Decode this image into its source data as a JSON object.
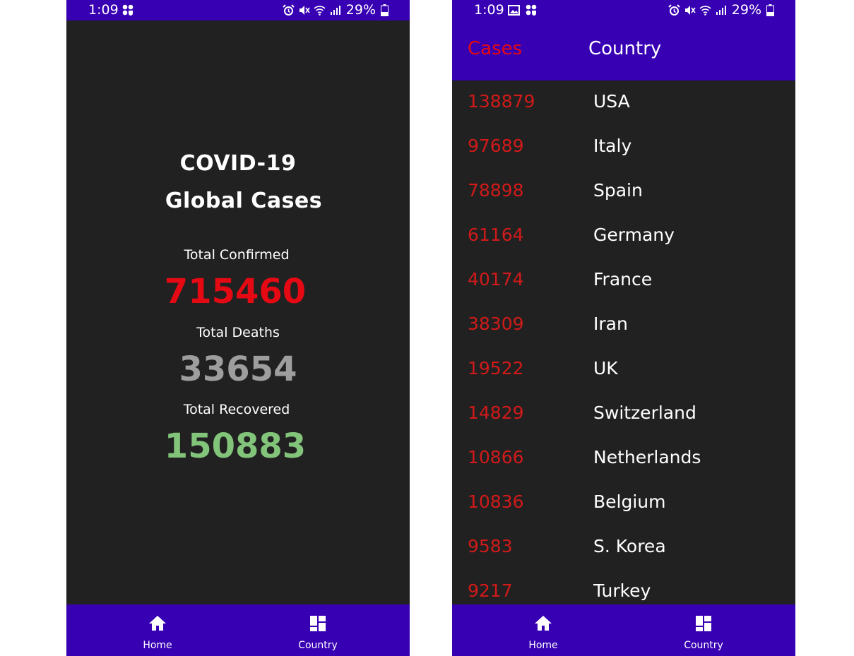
{
  "status_bar": {
    "time": "1:09",
    "battery_percent": "29%"
  },
  "home_screen": {
    "title_line1": "COVID-19",
    "title_line2": "Global Cases",
    "confirmed_label": "Total Confirmed",
    "confirmed_value": "715460",
    "deaths_label": "Total Deaths",
    "deaths_value": "33654",
    "recovered_label": "Total Recovered",
    "recovered_value": "150883",
    "colors": {
      "confirmed": "#e50914",
      "deaths": "#9e9e9e",
      "recovered": "#81c47a"
    }
  },
  "country_screen": {
    "header": {
      "cases_label": "Cases",
      "country_label": "Country"
    },
    "rows": [
      {
        "cases": "138879",
        "country": "USA"
      },
      {
        "cases": "97689",
        "country": "Italy"
      },
      {
        "cases": "78898",
        "country": "Spain"
      },
      {
        "cases": "61164",
        "country": "Germany"
      },
      {
        "cases": "40174",
        "country": "France"
      },
      {
        "cases": "38309",
        "country": "Iran"
      },
      {
        "cases": "19522",
        "country": "UK"
      },
      {
        "cases": "14829",
        "country": "Switzerland"
      },
      {
        "cases": "10866",
        "country": "Netherlands"
      },
      {
        "cases": "10836",
        "country": "Belgium"
      },
      {
        "cases": "9583",
        "country": "S. Korea"
      },
      {
        "cases": "9217",
        "country": "Turkey"
      }
    ]
  },
  "bottom_nav": {
    "items": [
      {
        "label": "Home",
        "icon": "home-icon"
      },
      {
        "label": "Country",
        "icon": "dashboard-icon"
      }
    ]
  },
  "theme": {
    "primary": "#3700b3",
    "background": "#212121"
  }
}
